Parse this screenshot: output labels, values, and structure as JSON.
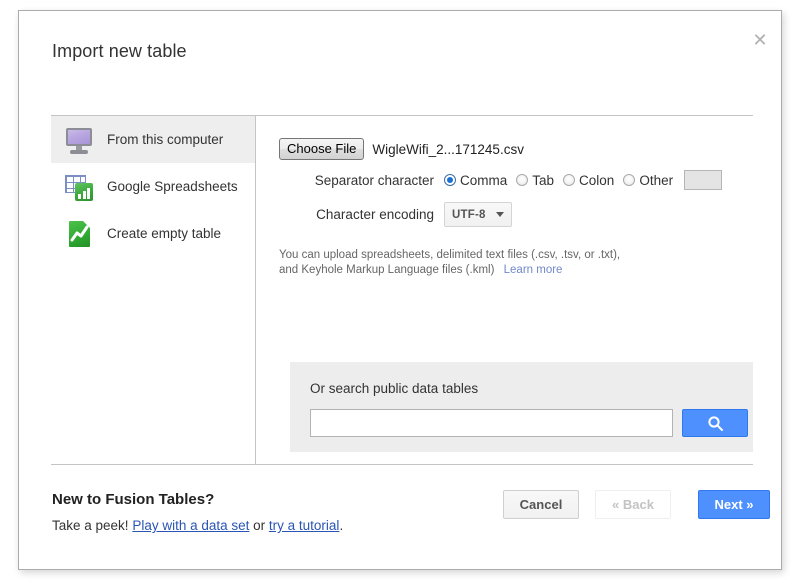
{
  "dialog": {
    "title": "Import new table",
    "close_icon": "close-icon"
  },
  "sidebar": {
    "items": [
      {
        "label": "From this computer",
        "icon": "monitor-icon",
        "selected": true
      },
      {
        "label": "Google Spreadsheets",
        "icon": "spreadsheet-icon",
        "selected": false
      },
      {
        "label": "Create empty table",
        "icon": "green-chart-doc-icon",
        "selected": false
      }
    ]
  },
  "file": {
    "choose_label": "Choose File",
    "file_name": "WigleWifi_2...171245.csv"
  },
  "separator": {
    "label": "Separator character",
    "options": [
      {
        "label": "Comma",
        "checked": true
      },
      {
        "label": "Tab",
        "checked": false
      },
      {
        "label": "Colon",
        "checked": false
      },
      {
        "label": "Other",
        "checked": false
      }
    ],
    "other_value": ""
  },
  "encoding": {
    "label": "Character encoding",
    "value": "UTF-8"
  },
  "helper": {
    "line1": "You can upload spreadsheets, delimited text files (.csv, .tsv, or .txt),",
    "line2": "and Keyhole Markup Language files (.kml)",
    "learn_more": "Learn more"
  },
  "search": {
    "title": "Or search public data tables",
    "value": "",
    "placeholder": "",
    "button_icon": "search-icon"
  },
  "footer": {
    "heading": "New to Fusion Tables?",
    "sub_prefix": "Take a peek! ",
    "link1": "Play with a data set",
    "sub_middle": " or ",
    "link2": "try a tutorial",
    "sub_suffix": ".",
    "cancel_label": "Cancel",
    "back_label": "« Back",
    "next_label": "Next »"
  },
  "colors": {
    "accent_blue": "#4d90fe",
    "link_blue": "#2a55b5",
    "panel_gray": "#ededed",
    "selected_gray": "#eeeeee"
  }
}
